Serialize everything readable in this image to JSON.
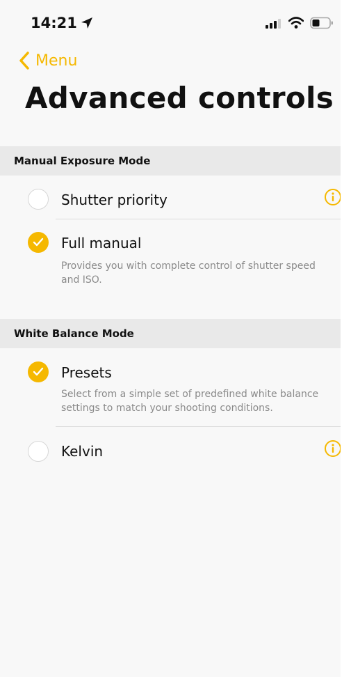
{
  "status_bar": {
    "time": "14:21",
    "icons": [
      "location-arrow-icon",
      "signal-icon",
      "wifi-icon",
      "battery-icon"
    ]
  },
  "nav": {
    "back_label": "Menu",
    "title": "Advanced controls"
  },
  "colors": {
    "accent": "#f5b800",
    "background": "#f8f8f8",
    "section_header_bg": "#e9e9e9",
    "description_text": "#8a8a8a"
  },
  "sections": [
    {
      "header": "Manual Exposure Mode",
      "options": [
        {
          "label": "Shutter priority",
          "selected": false,
          "has_info": true
        },
        {
          "label": "Full manual",
          "selected": true,
          "description": "Provides you with complete control of shutter speed and ISO."
        }
      ]
    },
    {
      "header": "White Balance Mode",
      "options": [
        {
          "label": "Presets",
          "selected": true,
          "description": "Select from a simple set of predefined white balance settings to match your shooting conditions."
        },
        {
          "label": "Kelvin",
          "selected": false,
          "has_info": true
        }
      ]
    }
  ]
}
